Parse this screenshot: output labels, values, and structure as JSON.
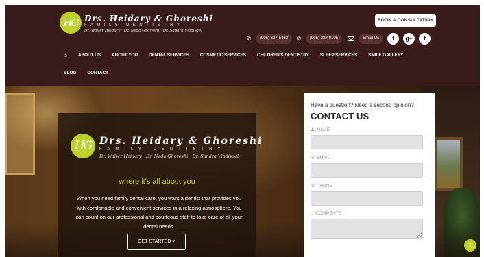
{
  "header": {
    "logo": {
      "monogram": "HG",
      "title": "Drs. Heidary & Ghoreshi",
      "subtitle": "FAMILY DENTISTRY",
      "doctors": "Dr. Walter Heidary · Dr. Neda Ghoreshi · Dr. Sandra Vladisdel"
    },
    "book_button": "BOOK A CONSULTATION",
    "phones": [
      "(905) 637-5463",
      "(905) 332-0105"
    ],
    "email_label": "Email Us",
    "social": [
      "f",
      "g+",
      "t"
    ]
  },
  "nav": {
    "row1": [
      "ABOUT US",
      "ABOUT YOU",
      "DENTAL SERVICES",
      "COSMETIC SERVICES",
      "CHILDREN'S DENTISTRY",
      "SLEEP SERVICES",
      "SMILE GALLERY"
    ],
    "row2": [
      "BLOG",
      "CONTACT"
    ]
  },
  "hero": {
    "logo": {
      "monogram": "HG",
      "title": "Drs. Heidary & Ghoreshi",
      "subtitle": "FAMILY DENTISTRY",
      "doctors": "Dr. Walter Heidary · Dr. Neda Ghoreshi · Dr. Sandra Vladisdel"
    },
    "tagline": "where it's all about you",
    "body": "When you need family dental care, you want a dentist that provides you with comfortable and convenient services in a relaxing atmosphere. You can count on our professional and courteous staff to take care of all your dental needs.",
    "cta": "GET STARTED ▾"
  },
  "contact_form": {
    "question": "Have a question? Need a second opinion?",
    "title": "CONTACT US",
    "fields": [
      {
        "label": "NAME",
        "icon": "user-icon"
      },
      {
        "label": "EMAIL",
        "icon": "envelope-icon"
      },
      {
        "label": "PHONE",
        "icon": "phone-icon"
      },
      {
        "label": "COMMENTS",
        "icon": "comment-icon"
      }
    ]
  },
  "colors": {
    "header_bg": "#3a1b1b",
    "accent": "#bcd12c",
    "panel_bg": "#ffffff"
  }
}
